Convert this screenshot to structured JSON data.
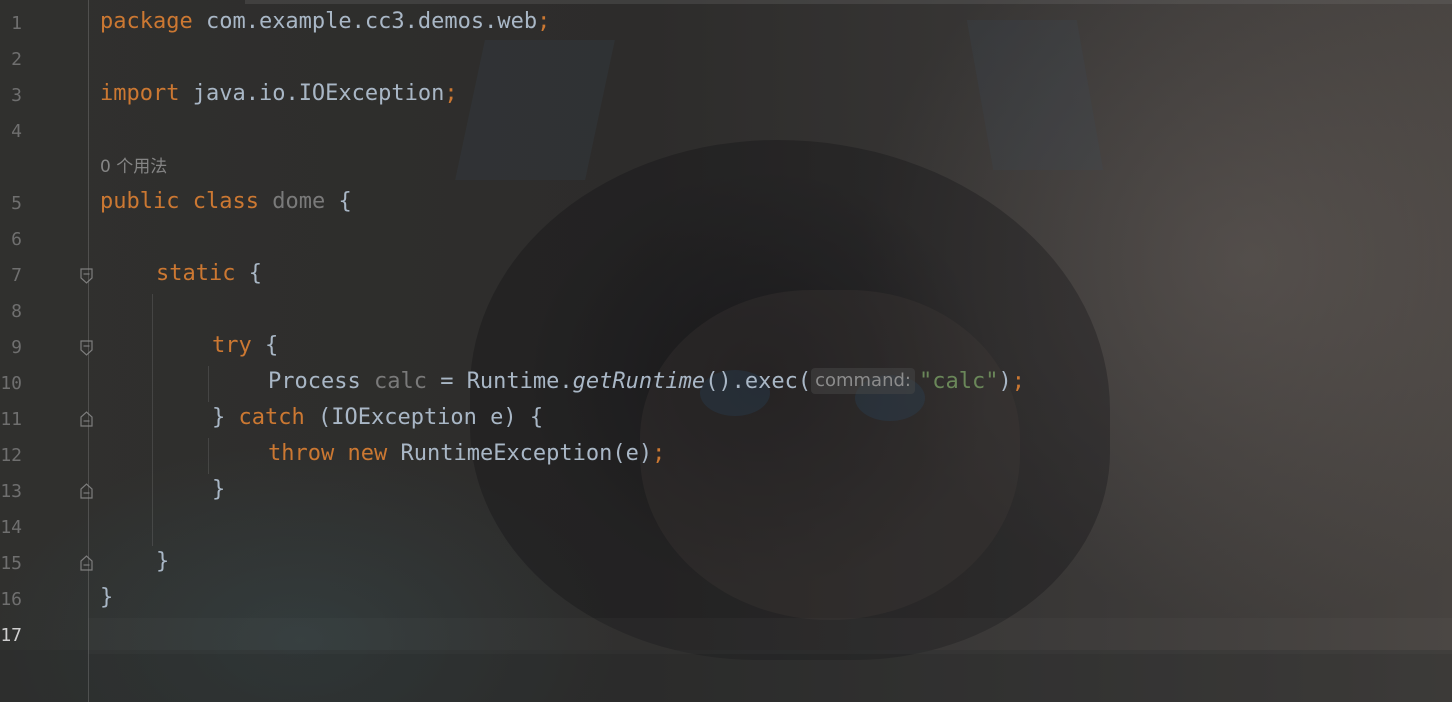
{
  "gutter": {
    "line_numbers": [
      "1",
      "2",
      "3",
      "4",
      "5",
      "6",
      "7",
      "8",
      "9",
      "10",
      "11",
      "12",
      "13",
      "14",
      "15",
      "16",
      "17"
    ],
    "current_line": "17"
  },
  "code": {
    "line1": {
      "kw": "package",
      "rest": " com.example.cc3.demos.web",
      "semi": ";"
    },
    "line3": {
      "kw": "import",
      "rest": " java.io.IOException",
      "semi": ";"
    },
    "usage_hint": "0 个用法",
    "line5": {
      "kw_public": "public",
      "kw_class": "class",
      "class_name": "dome",
      "brace": " {"
    },
    "line7": {
      "kw": "static",
      "brace": " {"
    },
    "line9": {
      "kw": "try",
      "brace": " {"
    },
    "line10": {
      "type": "Process ",
      "var": "calc",
      "assign": " = Runtime.",
      "method": "getRuntime",
      "call": "().exec(",
      "param_hint": "command:",
      "arg": "\"calc\"",
      "close": ")",
      "semi": ";"
    },
    "line11": {
      "close": "} ",
      "kw": "catch",
      "rest": " (IOException e) {"
    },
    "line12": {
      "kw_throw": "throw",
      "kw_new": "new",
      "rest": " RuntimeException(e)",
      "semi": ";"
    },
    "line13": {
      "text": "}"
    },
    "line15": {
      "text": "}"
    },
    "line16": {
      "text": "}"
    }
  },
  "colors": {
    "keyword": "#cc7832",
    "plain": "#a9b7c6",
    "string": "#6a8759",
    "unused": "#7a7a7a",
    "line_number": "#6f6f6f"
  },
  "icons": [
    "fold-open-icon",
    "fold-close-icon"
  ]
}
